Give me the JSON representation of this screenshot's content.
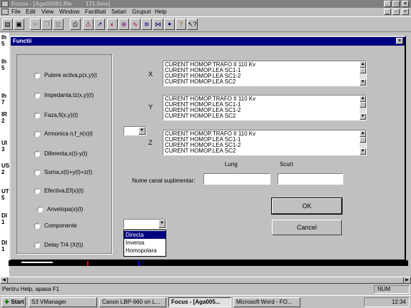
{
  "app": {
    "title": "Focus - [Aga00561.ffw",
    "timing": "171.0ms]"
  },
  "menu": [
    "File",
    "Edit",
    "View",
    "Window",
    "Facilitati",
    "Setari",
    "Grupuri",
    "Help"
  ],
  "left_labels": [
    "Ih 5",
    "Ih 5",
    "Ih 7",
    "IR 2",
    "UI 3",
    "US 2",
    "UT 5",
    "DI 1",
    "DI 1"
  ],
  "dialog": {
    "title": "Functii",
    "functions": [
      "Putere activa,p(x,y)(t",
      "Impedanta,Iz(x,y)(t)",
      "Faza,fi(x,y)(t)",
      "Armonica n,f_n(x)(t",
      "Diferenta,x(t)-y(t)",
      "Suma,x(t)+y(t)+z(t)",
      "Efectiva,Ef(x)(t)",
      "Anvelopa(x)(t)",
      "Componente",
      "Delay T/4 (X(t))"
    ],
    "axes": {
      "x": "X",
      "y": "Y",
      "z": "Z"
    },
    "lists": {
      "x": [
        "CURENT HOMOP.TRAFO II 110 Kv",
        "CURENT HOMOP.LEA SC1-1",
        "CURENT HOMOP.LEA SC1-2",
        "CURENT HOMOP.LEA SC2"
      ],
      "y": [
        "CURENT HOMOP.TRAFO II 110 Kv",
        "CURENT HOMOP.LEA SC1-1",
        "CURENT HOMOP.LEA SC1-2",
        "CURENT HOMOP.LEA SC2"
      ],
      "z": [
        "CURENT HOMOP.TRAFO II 110 Kv",
        "CURENT HOMOP.LEA SC1-1",
        "CURENT HOMOP.LEA SC1-2",
        "CURENT HOMOP.LEA SC2"
      ]
    },
    "lung_label": "Lung",
    "scurt_label": "Scurt",
    "name_label": "Nume canal suplimentar:",
    "ok": "OK",
    "cancel": "Cancel",
    "component_options": [
      "Directa",
      "Inversa",
      "Homopolara"
    ],
    "component_selected": "Directa"
  },
  "status": {
    "help": "Pentru Help, apasa F1",
    "num": "NUM"
  },
  "taskbar": {
    "start": "Start",
    "tasks": [
      "S3 VManager",
      "Canon LBP-660 on L...",
      "Focus - [Aga005...",
      "Microsoft Word - FO..."
    ],
    "clock": "12:34"
  }
}
